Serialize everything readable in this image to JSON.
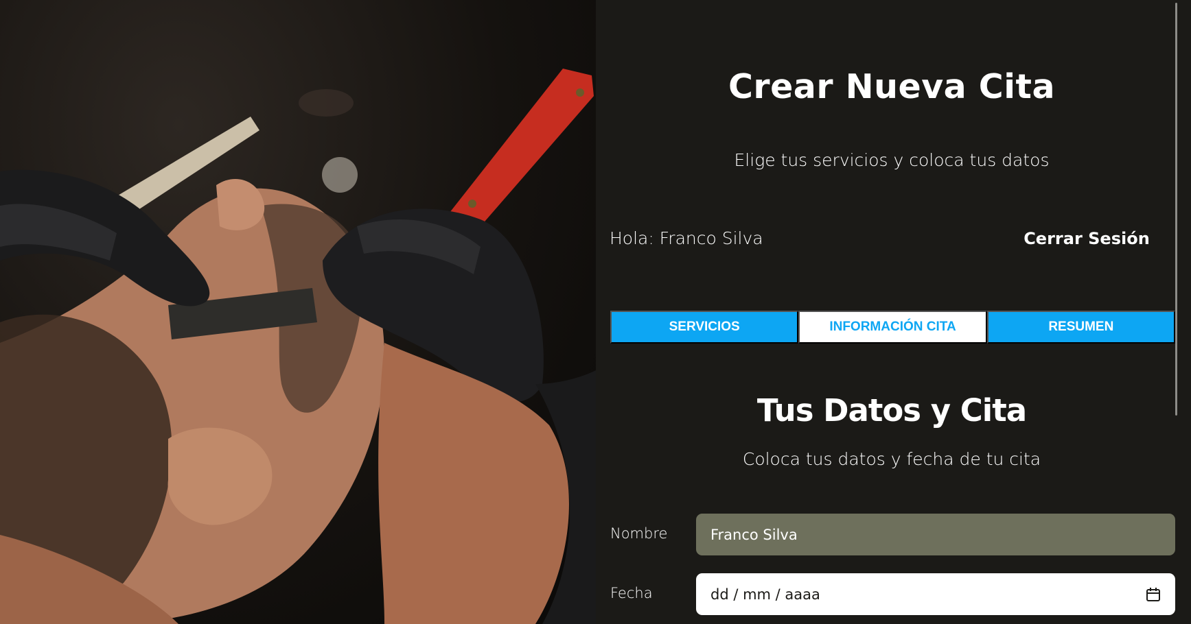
{
  "header": {
    "title": "Crear Nueva Cita",
    "subtitle": "Elige tus servicios y coloca tus datos"
  },
  "session": {
    "greeting": "Hola: Franco Silva",
    "logout_label": "Cerrar Sesión"
  },
  "tabs": [
    {
      "label": "Servicios",
      "active": false
    },
    {
      "label": "Información Cita",
      "active": true
    },
    {
      "label": "Resumen",
      "active": false
    }
  ],
  "section": {
    "title": "Tus Datos y Cita",
    "subtitle": "Coloca tus datos y fecha de tu cita"
  },
  "form": {
    "name_label": "Nombre",
    "name_value": "Franco Silva",
    "date_label": "Fecha",
    "date_placeholder": "dd / mm / aaaa"
  },
  "icons": {
    "calendar": "calendar-icon"
  },
  "colors": {
    "background": "#1b1a17",
    "accent": "#0da6f3",
    "name_field": "#6e705c",
    "white": "#ffffff"
  }
}
